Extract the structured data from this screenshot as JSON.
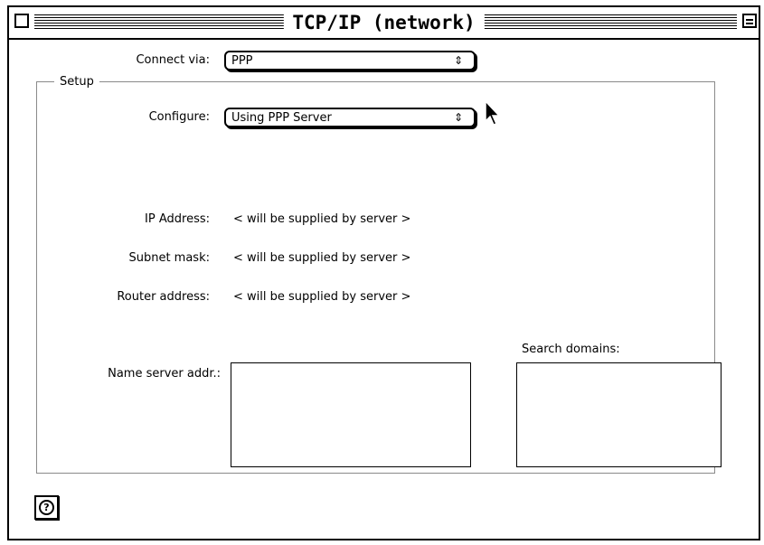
{
  "window": {
    "title": "TCP/IP (network)"
  },
  "connect_via": {
    "label": "Connect via:",
    "value": "PPP"
  },
  "setup": {
    "title": "Setup",
    "configure": {
      "label": "Configure:",
      "value": "Using PPP Server"
    },
    "ip_address": {
      "label": "IP Address:",
      "value": "< will be supplied by server >"
    },
    "subnet_mask": {
      "label": "Subnet mask:",
      "value": "< will be supplied by server >"
    },
    "router_address": {
      "label": "Router address:",
      "value": "< will be supplied by server >"
    },
    "name_server": {
      "label": "Name server addr.:",
      "value": ""
    },
    "search_domains": {
      "label": "Search domains:",
      "value": ""
    }
  },
  "icons": {
    "help": "help-icon",
    "close": "close-box-icon",
    "zoom": "zoom-box-icon",
    "cursor": "arrow-cursor-icon",
    "popup_arrows": "⇕"
  }
}
